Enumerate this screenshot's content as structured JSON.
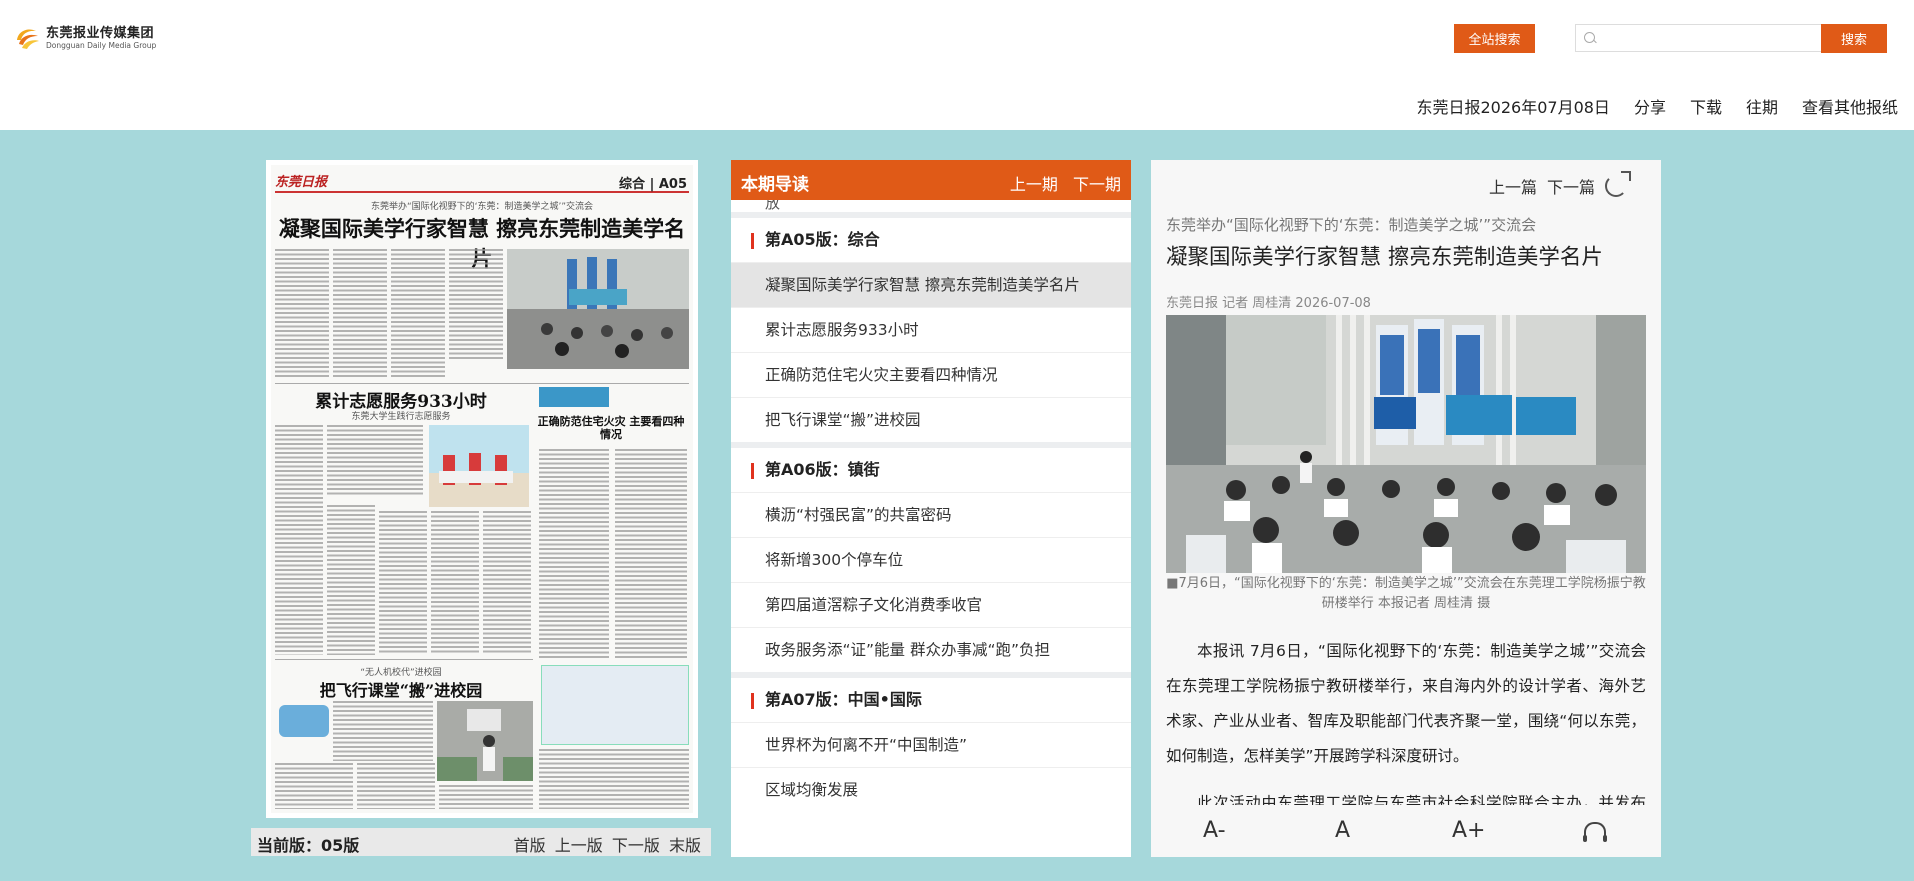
{
  "header": {
    "logo_cn": "东莞报业传媒集团",
    "logo_en": "Dongguan Daily Media Group",
    "site_search_label": "全站搜索",
    "search_placeholder": "",
    "search_button": "搜索"
  },
  "topnav": {
    "date": "东莞日报2026年07月08日",
    "share": "分享",
    "download": "下载",
    "archive": "往期",
    "other_papers": "查看其他报纸"
  },
  "paper": {
    "masthead": "东莞日报",
    "section": "综合 | A05",
    "kicker1": "东莞举办“国际化视野下的‘东莞：制造美学之城’”交流会",
    "headline1": "凝聚国际美学行家智慧 擦亮东莞制造美学名片",
    "headline2": "累计志愿服务933小时",
    "kicker2": "东莞大学生践行志愿服务",
    "headline3": "正确防范住宅火灾 主要看四种情况",
    "kicker3": "“无人机校代”进校园",
    "headline4": "把飞行课堂“搬”进校园"
  },
  "pager": {
    "current": "当前版：05版",
    "first": "首版",
    "prev": "上一版",
    "next": "下一版",
    "last": "末版"
  },
  "guide": {
    "title": "本期导读",
    "prev_issue": "上一期",
    "next_issue": "下一期",
    "sections": [
      {
        "title": "第A05版：综合",
        "articles": [
          "凝聚国际美学行家智慧 擦亮东莞制造美学名片",
          "累计志愿服务933小时",
          "正确防范住宅火灾主要看四种情况",
          "把飞行课堂“搬”进校园"
        ]
      },
      {
        "title": "第A06版：镇街",
        "articles": [
          "横沥“村强民富”的共富密码",
          "将新增300个停车位",
          "第四届道滘粽子文化消费季收官",
          "政务服务添“证”能量 群众办事减“跑”负担"
        ]
      },
      {
        "title": "第A07版：中国•国际",
        "articles": [
          "世界杯为何离不开“中国制造”",
          "区域均衡发展"
        ]
      }
    ]
  },
  "reader": {
    "prev_article": "上一篇",
    "next_article": "下一篇",
    "subtitle": "东莞举办“国际化视野下的‘东莞：制造美学之城’”交流会",
    "title": "凝聚国际美学行家智慧 擦亮东莞制造美学名片",
    "byline": "东莞日报 记者 周桂清 2026-07-08",
    "caption": "■7月6日，“国际化视野下的‘东莞：制造美学之城’”交流会在东莞理工学院杨振宁教研楼举行 本报记者 周桂清 摄",
    "paragraphs": [
      "本报讯 7月6日，“国际化视野下的‘东莞：制造美学之城’”交流会在东莞理工学院杨振宁教研楼举行，来自海内外的设计学者、海外艺术家、产业从业者、智库及职能部门代表齐聚一堂，围绕“何以东莞，如何制造，怎样美学”开展跨学科深度研讨。",
      "此次活动由东莞理工学院与东莞市社会科学院联合主办，并发布了《东莞制造美学研究院”建设”制造美学》设计推广工程”系列"
    ],
    "font_small": "A-",
    "font_mid": "A",
    "font_large": "A+"
  }
}
